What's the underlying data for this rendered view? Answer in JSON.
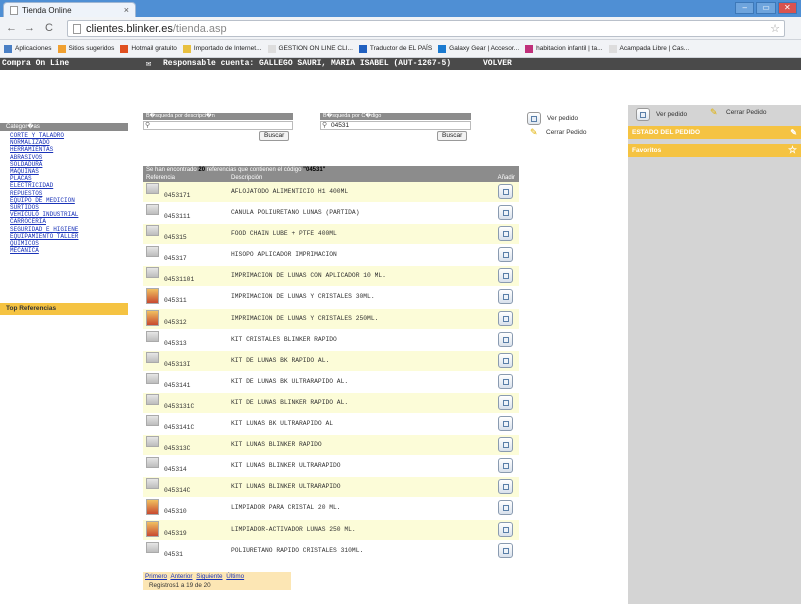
{
  "browser": {
    "tab_title": "Tienda Online",
    "tab_close": "×",
    "url_host": "clientes.blinker.es",
    "url_path": "/tienda.asp",
    "nav_back": "←",
    "nav_forward": "→",
    "nav_reload": "C",
    "window_controls": [
      "–",
      "▭",
      "✕"
    ],
    "bookmarks": [
      {
        "label": "Aplicaciones",
        "icon_color": "#4a7fc4"
      },
      {
        "label": "Sitios sugeridos",
        "icon_color": "#f0a030"
      },
      {
        "label": "Hotmail gratuito",
        "icon_color": "#e05020"
      },
      {
        "label": "Importado de Internet...",
        "icon_color": "#e8c040"
      },
      {
        "label": "GESTION ON LINE CLI...",
        "icon_color": "#dddddd"
      },
      {
        "label": "Traductor de EL PAÍS",
        "icon_color": "#2060c0"
      },
      {
        "label": "Galaxy Gear | Accesor...",
        "icon_color": "#1a7ad0"
      },
      {
        "label": "habitacion infantil | ta...",
        "icon_color": "#c0307a"
      },
      {
        "label": "Acampada Libre | Cas...",
        "icon_color": "#dddddd"
      }
    ]
  },
  "header": {
    "brand": "Compra On Line",
    "mail_icon": "✉",
    "responsable": "Responsable cuenta: GALLEGO SAURI, MARIA ISABEL (AUT-1267-5)",
    "volver": "VOLVER"
  },
  "sidebar": {
    "category_heading": "Categor�as",
    "categories": [
      "CORTE Y TALADRO",
      "NORMALIZADO",
      "HERRAMIENTAS",
      "ABRASIVOS",
      "SOLDADURA",
      "MAQUINAS",
      "PLACAS",
      "ELECTRICIDAD",
      "REPUESTOS",
      "EQUIPO DE MEDICION",
      "SURTIDOS",
      "VEHICULO INDUSTRIAL",
      "CARROCERIA",
      "SEGURIDAD E HIGIENE",
      "EQUIPAMIENTO TALLER",
      "QUIMICOS",
      "MECANICA"
    ],
    "top_references": "Top Referencias"
  },
  "search": {
    "desc_heading": "B�squeda por descripci�n",
    "desc_value": "",
    "code_heading": "B�squeda por C�digo",
    "code_value": "04531",
    "button": "Buscar"
  },
  "order_links": {
    "ver_pedido": "Ver pedido",
    "cerrar_pedido": "Cerrar Pedido"
  },
  "results": {
    "summary_prefix": "Se han encontrado ",
    "summary_count": "20",
    "summary_mid": " referencias que contienen el código ",
    "summary_code": "\"04531\"",
    "col_ref": "Referencia",
    "col_desc": "Descripción",
    "col_add": "Añadir",
    "rows": [
      {
        "code": "0453171",
        "desc": "AFLOJATODO ALIMENTICIO H1 400ML",
        "thumb": "box"
      },
      {
        "code": "0453111",
        "desc": "CANULA POLIURETANO LUNAS (PARTIDA)",
        "thumb": "box"
      },
      {
        "code": "045315",
        "desc": "FOOD CHAIN LUBE + PTFE 400ML",
        "thumb": "box"
      },
      {
        "code": "045317",
        "desc": "HISOPO APLICADOR IMPRIMACION",
        "thumb": "box"
      },
      {
        "code": "04531101",
        "desc": "IMPRIMACION DE LUNAS CON APLICADOR 10 ML.",
        "thumb": "box"
      },
      {
        "code": "045311",
        "desc": "IMPRIMACION DE LUNAS Y CRISTALES 30ML.",
        "thumb": "photo"
      },
      {
        "code": "045312",
        "desc": "IMPRIMACION DE LUNAS Y CRISTALES 250ML.",
        "thumb": "photo"
      },
      {
        "code": "045313",
        "desc": "KIT CRISTALES BLINKER RAPIDO",
        "thumb": "box"
      },
      {
        "code": "045313I",
        "desc": "KIT DE LUNAS BK RAPIDO AL.",
        "thumb": "box"
      },
      {
        "code": "0453141",
        "desc": "KIT DE LUNAS BK ULTRARAPIDO AL.",
        "thumb": "box"
      },
      {
        "code": "0453131C",
        "desc": "KIT DE LUNAS BLINKER RAPIDO AL.",
        "thumb": "box"
      },
      {
        "code": "0453141C",
        "desc": "KIT LUNAS BK ULTRARAPIDO AL",
        "thumb": "box"
      },
      {
        "code": "045313C",
        "desc": "KIT LUNAS BLINKER RAPIDO",
        "thumb": "box"
      },
      {
        "code": "045314",
        "desc": "KIT LUNAS BLINKER ULTRARAPIDO",
        "thumb": "box"
      },
      {
        "code": "045314C",
        "desc": "KIT LUNAS BLINKER ULTRARAPIDO",
        "thumb": "box"
      },
      {
        "code": "045310",
        "desc": "LIMPIADOR PARA CRISTAL 20 ML.",
        "thumb": "photo"
      },
      {
        "code": "045319",
        "desc": "LIMPIADOR-ACTIVADOR LUNAS 250 ML.",
        "thumb": "photo"
      },
      {
        "code": "04531",
        "desc": "POLIURETANO RAPIDO CRISTALES 310ML.",
        "thumb": "box"
      }
    ],
    "pager": {
      "first": "Primero",
      "prev": "Anterior",
      "next": "Siguiente",
      "last": "Último",
      "count": "Registros1 a 19 de 20"
    }
  },
  "right_panel": {
    "ver_pedido": "Ver pedido",
    "cerrar_pedido": "Cerrar Pedido",
    "estado": "ESTADO DEL PEDIDO",
    "favoritos": "Favoritos",
    "favoritos_icon": "☆",
    "estado_icon": "✎"
  },
  "colors": {
    "accent_yellow": "#f5c342",
    "header_gray": "#4a4a4a",
    "row_yellow": "#fcfcd8",
    "link_blue": "#1a33b8"
  }
}
